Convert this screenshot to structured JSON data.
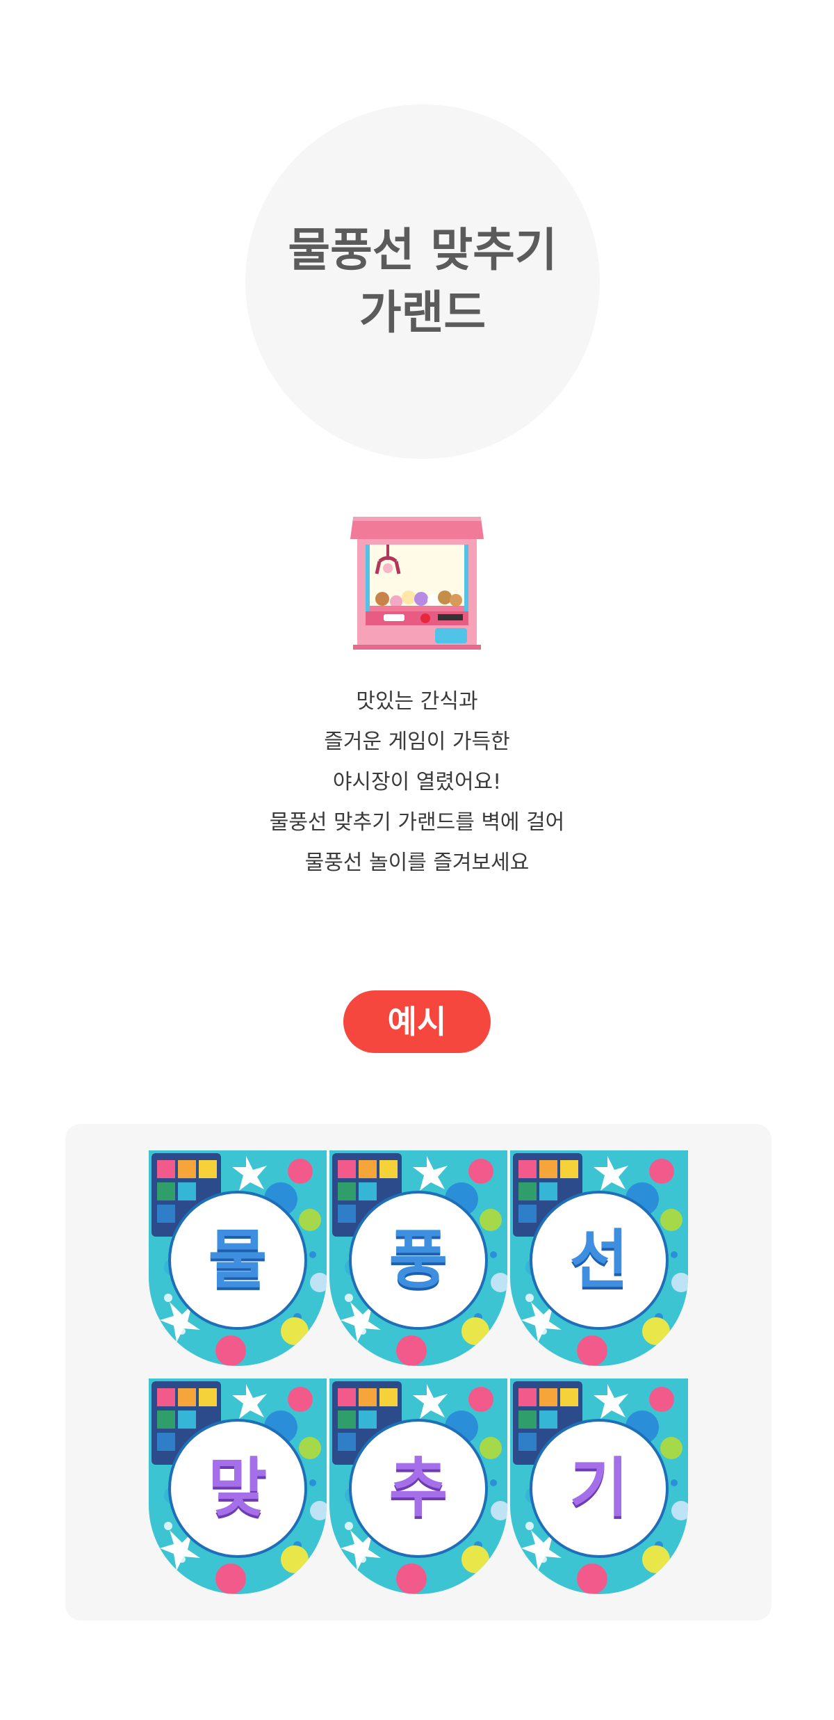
{
  "hero": {
    "title_line1": "물풍선 맞추기",
    "title_line2": "가랜드"
  },
  "description": [
    "맛있는 간식과",
    "즐거운 게임이 가득한",
    "야시장이 열렸어요!",
    "물풍선 맞추기 가랜드를 벽에 걸어",
    "물풍선 놀이를 즐겨보세요"
  ],
  "example": {
    "badge_label": "예시",
    "pennants": [
      {
        "letter": "물",
        "color": "blue"
      },
      {
        "letter": "풍",
        "color": "blue"
      },
      {
        "letter": "선",
        "color": "blue"
      },
      {
        "letter": "맞",
        "color": "purple"
      },
      {
        "letter": "추",
        "color": "purple"
      },
      {
        "letter": "기",
        "color": "purple"
      }
    ]
  },
  "colors": {
    "accent_red": "#f5473e",
    "panel_bg": "#f6f6f6",
    "pennant_teal": "#3cc4d3",
    "letter_blue": "#3f8fe0",
    "letter_purple": "#a46fe8"
  },
  "icons": {
    "claw_machine": "claw-machine-icon"
  }
}
